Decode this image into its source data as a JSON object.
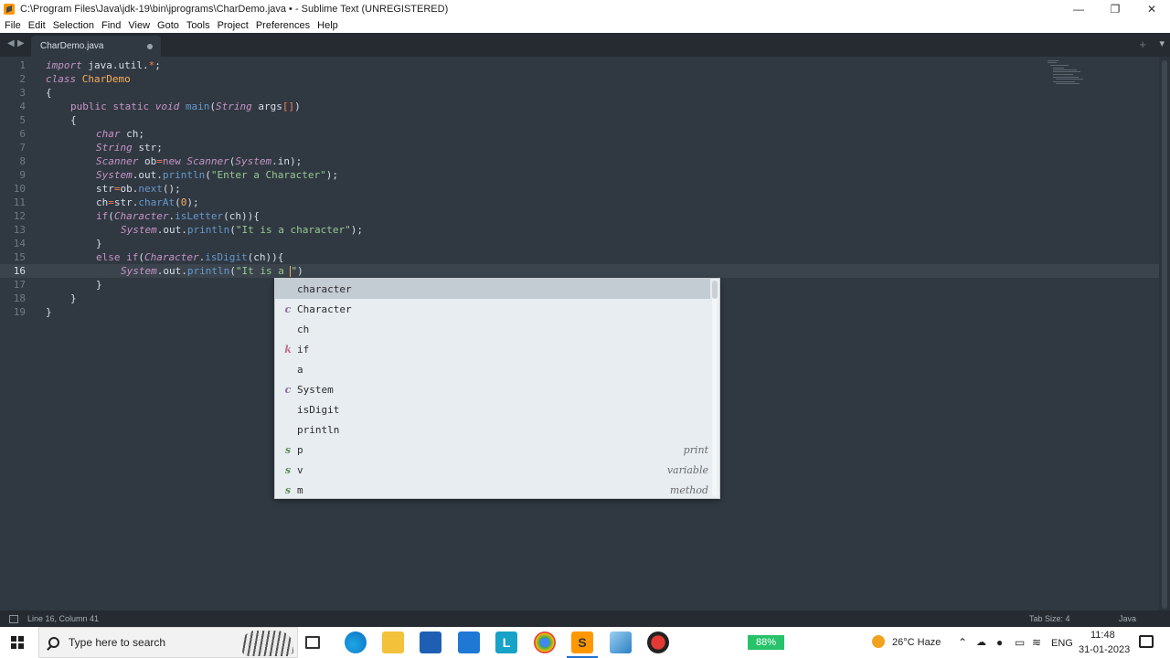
{
  "window": {
    "title": "C:\\Program Files\\Java\\jdk-19\\bin\\jprograms\\CharDemo.java • - Sublime Text (UNREGISTERED)",
    "minimize_glyph": "—",
    "maximize_glyph": "❐",
    "close_glyph": "✕"
  },
  "menu": [
    "File",
    "Edit",
    "Selection",
    "Find",
    "View",
    "Goto",
    "Tools",
    "Project",
    "Preferences",
    "Help"
  ],
  "tabs": {
    "active": "CharDemo.java",
    "nav_left": "◀",
    "nav_right": "▶",
    "plus": "+",
    "menu": "▾"
  },
  "editor": {
    "active_line": 16,
    "line_numbers": [
      "1",
      "2",
      "3",
      "4",
      "5",
      "6",
      "7",
      "8",
      "9",
      "10",
      "11",
      "12",
      "13",
      "14",
      "15",
      "16",
      "17",
      "18",
      "19"
    ],
    "code": {
      "l1": [
        "import",
        " java.util.",
        "*",
        ";"
      ],
      "l2": [
        "class",
        " ",
        "CharDemo"
      ],
      "l3": [
        "{"
      ],
      "l4": [
        "public",
        " ",
        "static",
        " ",
        "void",
        " ",
        "main",
        "(",
        "String",
        " args",
        "[]",
        ")"
      ],
      "l5": [
        "{"
      ],
      "l6": [
        "char",
        " ch;"
      ],
      "l7": [
        "String",
        " str;"
      ],
      "l8": [
        "Scanner",
        " ob",
        "=",
        "new",
        " ",
        "Scanner",
        "(",
        "System",
        ".in);"
      ],
      "l9": [
        "System",
        ".out.",
        "println",
        "(",
        "\"Enter a Character\"",
        ");"
      ],
      "l10": [
        "str",
        "=",
        "ob.",
        "next",
        "();"
      ],
      "l11": [
        "ch",
        "=",
        "str.",
        "charAt",
        "(",
        "0",
        ");"
      ],
      "l12": [
        "if",
        "(",
        "Character",
        ".",
        "isLetter",
        "(ch)){"
      ],
      "l13": [
        "System",
        ".out.",
        "println",
        "(",
        "\"It is a character\"",
        ");"
      ],
      "l14": [
        "}"
      ],
      "l15": [
        "else",
        " ",
        "if",
        "(",
        "Character",
        ".",
        "isDigit",
        "(ch)){"
      ],
      "l16": [
        "System",
        ".out.",
        "println",
        "(",
        "\"It is a ",
        "\"",
        ")"
      ],
      "l17": [
        "}"
      ],
      "l18": [
        "}"
      ],
      "l19": [
        "}"
      ]
    }
  },
  "autocomplete": {
    "items": [
      {
        "kind": "",
        "label": "character",
        "hint": "",
        "selected": true
      },
      {
        "kind": "c",
        "label": "Character",
        "hint": ""
      },
      {
        "kind": "",
        "label": "ch",
        "hint": ""
      },
      {
        "kind": "k",
        "label": "if",
        "hint": ""
      },
      {
        "kind": "",
        "label": "a",
        "hint": ""
      },
      {
        "kind": "c",
        "label": "System",
        "hint": ""
      },
      {
        "kind": "",
        "label": "isDigit",
        "hint": ""
      },
      {
        "kind": "",
        "label": "println",
        "hint": ""
      },
      {
        "kind": "s",
        "label": "p",
        "hint": "print"
      },
      {
        "kind": "s",
        "label": "v",
        "hint": "variable"
      },
      {
        "kind": "s",
        "label": "m",
        "hint": "method"
      }
    ]
  },
  "status": {
    "position": "Line 16, Column 41",
    "tab_size": "Tab Size: 4",
    "syntax": "Java"
  },
  "taskbar": {
    "search_placeholder": "Type here to search",
    "battery": "88%",
    "weather": "26°C  Haze",
    "language": "ENG",
    "time": "11:48",
    "date": "31-01-2023",
    "chevron": "⌃"
  },
  "colors": {
    "editor_bg": "#303841",
    "tab_bg": "#252b31",
    "keyword": "#c695c6",
    "string": "#99c794",
    "function": "#6699cc",
    "class": "#f9ae58",
    "operator": "#f97b58",
    "popup_bg": "#e8edf1"
  }
}
